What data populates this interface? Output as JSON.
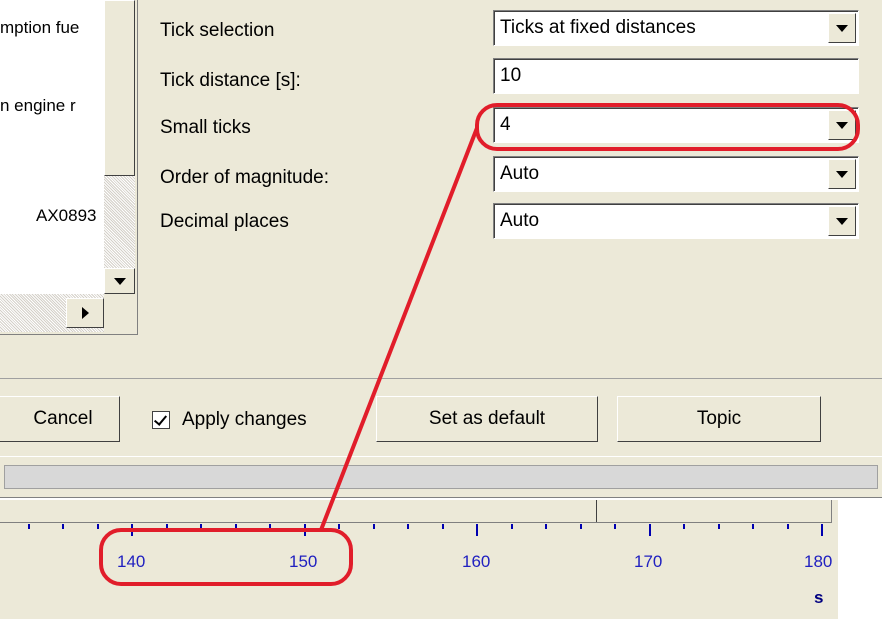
{
  "left_list": {
    "items": [
      "mption fue",
      "n engine r",
      "AX0893"
    ]
  },
  "properties": [
    {
      "label": "Tick selection",
      "value": "Ticks at fixed distances",
      "dropdown": true
    },
    {
      "label": "Tick distance [s]:",
      "value": "10",
      "dropdown": false
    },
    {
      "label": "Small ticks",
      "value": "4",
      "dropdown": true
    },
    {
      "label": "Order of magnitude:",
      "value": "Auto",
      "dropdown": true
    },
    {
      "label": "Decimal places",
      "value": "Auto",
      "dropdown": true
    }
  ],
  "buttons": {
    "cancel": "Cancel",
    "apply_changes": "Apply changes",
    "apply_changes_checked": true,
    "set_default": "Set as default",
    "topic": "Topic"
  },
  "axis": {
    "tick_labels": [
      "140",
      "150",
      "160",
      "170",
      "180"
    ],
    "unit": "s"
  },
  "colors": {
    "annotation": "#e11d2a",
    "axis_ticks": "#0000b0"
  }
}
